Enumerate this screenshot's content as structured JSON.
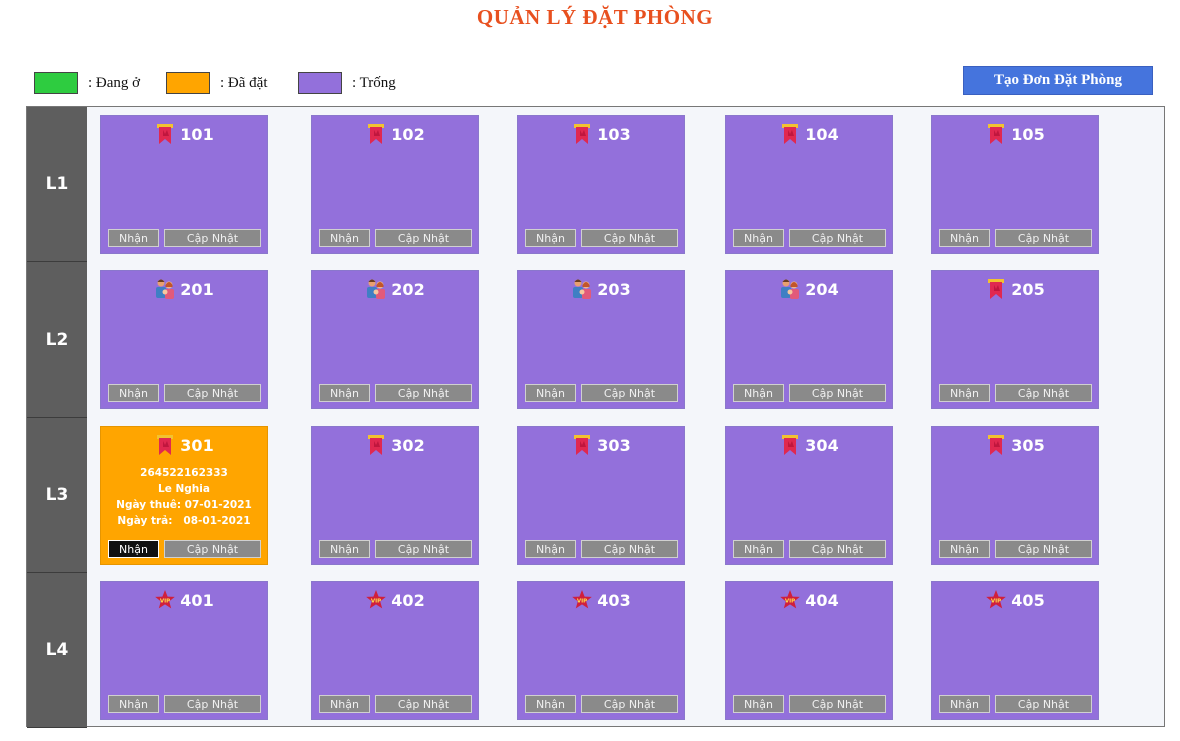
{
  "header": {
    "title": "QUẢN LÝ ĐẶT PHÒNG"
  },
  "legend": [
    {
      "label": ": Đang ở",
      "color": "#2ecc40"
    },
    {
      "label": ": Đã đặt",
      "color": "#ffa500"
    },
    {
      "label": ": Trống",
      "color": "#9370db"
    }
  ],
  "toolbar": {
    "create_label": "Tạo Đơn Đặt Phòng"
  },
  "colors": {
    "occupied": "#2ecc40",
    "booked": "#ffa500",
    "empty": "#9370db"
  },
  "buttons": {
    "receive": "Nhận",
    "update": "Cập Nhật"
  },
  "floors": [
    {
      "label": "L1",
      "rooms": [
        {
          "number": "101",
          "type": "bookmark-icon",
          "status": "empty"
        },
        {
          "number": "102",
          "type": "bookmark-icon",
          "status": "empty"
        },
        {
          "number": "103",
          "type": "bookmark-icon",
          "status": "empty"
        },
        {
          "number": "104",
          "type": "bookmark-icon",
          "status": "empty"
        },
        {
          "number": "105",
          "type": "bookmark-icon",
          "status": "empty"
        }
      ]
    },
    {
      "label": "L2",
      "rooms": [
        {
          "number": "201",
          "type": "family-icon",
          "status": "empty"
        },
        {
          "number": "202",
          "type": "family-icon",
          "status": "empty"
        },
        {
          "number": "203",
          "type": "family-icon",
          "status": "empty"
        },
        {
          "number": "204",
          "type": "family-icon",
          "status": "empty"
        },
        {
          "number": "205",
          "type": "bookmark-icon",
          "status": "empty"
        }
      ]
    },
    {
      "label": "L3",
      "rooms": [
        {
          "number": "301",
          "type": "bookmark-icon",
          "status": "booked",
          "info": {
            "id": "264522162333",
            "name": "Le Nghia",
            "checkin": "Ngày thuê: 07-01-2021",
            "checkout": "Ngày trả:   08-01-2021"
          }
        },
        {
          "number": "302",
          "type": "bookmark-icon",
          "status": "empty"
        },
        {
          "number": "303",
          "type": "bookmark-icon",
          "status": "empty"
        },
        {
          "number": "304",
          "type": "bookmark-icon",
          "status": "empty"
        },
        {
          "number": "305",
          "type": "bookmark-icon",
          "status": "empty"
        }
      ]
    },
    {
      "label": "L4",
      "rooms": [
        {
          "number": "401",
          "type": "vip-star-icon",
          "status": "empty"
        },
        {
          "number": "402",
          "type": "vip-star-icon",
          "status": "empty"
        },
        {
          "number": "403",
          "type": "vip-star-icon",
          "status": "empty"
        },
        {
          "number": "404",
          "type": "vip-star-icon",
          "status": "empty"
        },
        {
          "number": "405",
          "type": "vip-star-icon",
          "status": "empty"
        }
      ]
    }
  ]
}
